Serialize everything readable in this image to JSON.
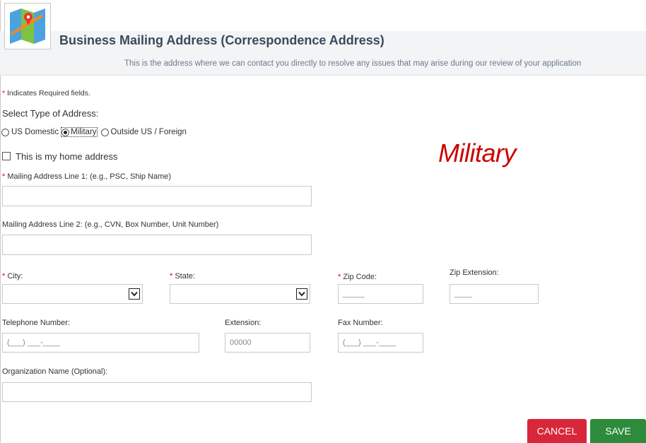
{
  "header": {
    "title": "Business Mailing Address (Correspondence Address)",
    "subtitle": "This is the address where we can contact you directly to resolve any issues that may arise during our review of your application",
    "logo_icon": "map-icon"
  },
  "form": {
    "required_asterisk": "*",
    "required_note": " Indicates Required fields.",
    "address_type_label": "Select Type of Address:",
    "address_types": [
      "US Domestic",
      "Military",
      "Outside US / Foreign"
    ],
    "selected_address_type": "Military",
    "home_address_checkbox": "This is my home address",
    "home_address_checked": false,
    "annotation": "Military",
    "address_line1_label": " Mailing Address Line 1: (e.g., PSC, Ship Name)",
    "address_line1_value": "",
    "address_line2_label": "Mailing Address Line 2: (e.g., CVN, Box Number, Unit Number)",
    "address_line2_value": "",
    "city_label": " City:",
    "city_value": "",
    "state_label": " State:",
    "state_value": "",
    "zip_label": " Zip Code:",
    "zip_placeholder": "_____",
    "zip_ext_label": "Zip Extension:",
    "zip_ext_placeholder": "____",
    "phone_label": "Telephone Number:",
    "phone_placeholder": "(___) ___-____",
    "extension_label": "Extension:",
    "extension_placeholder": "00000",
    "fax_label": "Fax Number:",
    "fax_placeholder": "(___) ___-____",
    "org_label": "Organization Name (Optional):",
    "org_value": ""
  },
  "buttons": {
    "cancel": "CANCEL",
    "save": "SAVE"
  },
  "colors": {
    "required": "#d0021b",
    "cancel": "#d8263a",
    "save": "#2e8b3c",
    "annotation": "#cc0000"
  }
}
